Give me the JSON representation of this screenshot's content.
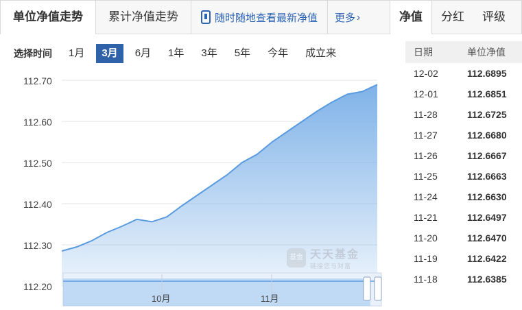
{
  "tabs": {
    "unit_nav_trend": "单位净值走势",
    "cumulative_nav_trend": "累计净值走势",
    "mobile_link": "随时随地查看最新净值",
    "more": "更多"
  },
  "right_tabs": [
    "净值",
    "分红",
    "评级"
  ],
  "range_selector": {
    "label": "选择时间",
    "options": [
      "1月",
      "3月",
      "6月",
      "1年",
      "3年",
      "5年",
      "今年",
      "成立来"
    ],
    "active": "3月"
  },
  "chart_data": {
    "type": "area",
    "title": "",
    "xlabel": "",
    "ylabel": "",
    "ylim": [
      112.2,
      112.7
    ],
    "y_ticks": [
      "112.70",
      "112.60",
      "112.50",
      "112.40",
      "112.30",
      "112.20"
    ],
    "x_ticks": [
      "10月",
      "11月"
    ],
    "fill_color": "#7fb2e8",
    "line_color": "#5a9be0",
    "series": [
      {
        "x": [
          "09-02",
          "09-05",
          "09-10",
          "09-15",
          "09-20",
          "09-25",
          "09-28",
          "10-01",
          "10-05",
          "10-10",
          "10-15",
          "10-20",
          "10-25",
          "10-28",
          "11-01",
          "11-05",
          "11-10",
          "11-15",
          "11-20",
          "11-25",
          "11-28",
          "12-02"
        ],
        "values": [
          112.285,
          112.295,
          112.31,
          112.33,
          112.345,
          112.362,
          112.356,
          112.368,
          112.395,
          112.42,
          112.445,
          112.47,
          112.5,
          112.52,
          112.55,
          112.575,
          112.6,
          112.625,
          112.647,
          112.666,
          112.6725,
          112.6895
        ]
      }
    ]
  },
  "watermark": {
    "logo": "基金",
    "title": "天天基金",
    "subtitle": "链接您与财富"
  },
  "nav_table": {
    "headers": [
      "日期",
      "单位净值"
    ],
    "rows": [
      [
        "12-02",
        "112.6895"
      ],
      [
        "12-01",
        "112.6851"
      ],
      [
        "11-28",
        "112.6725"
      ],
      [
        "11-27",
        "112.6680"
      ],
      [
        "11-26",
        "112.6667"
      ],
      [
        "11-25",
        "112.6663"
      ],
      [
        "11-24",
        "112.6630"
      ],
      [
        "11-21",
        "112.6497"
      ],
      [
        "11-20",
        "112.6470"
      ],
      [
        "11-19",
        "112.6422"
      ],
      [
        "11-18",
        "112.6385"
      ]
    ]
  }
}
